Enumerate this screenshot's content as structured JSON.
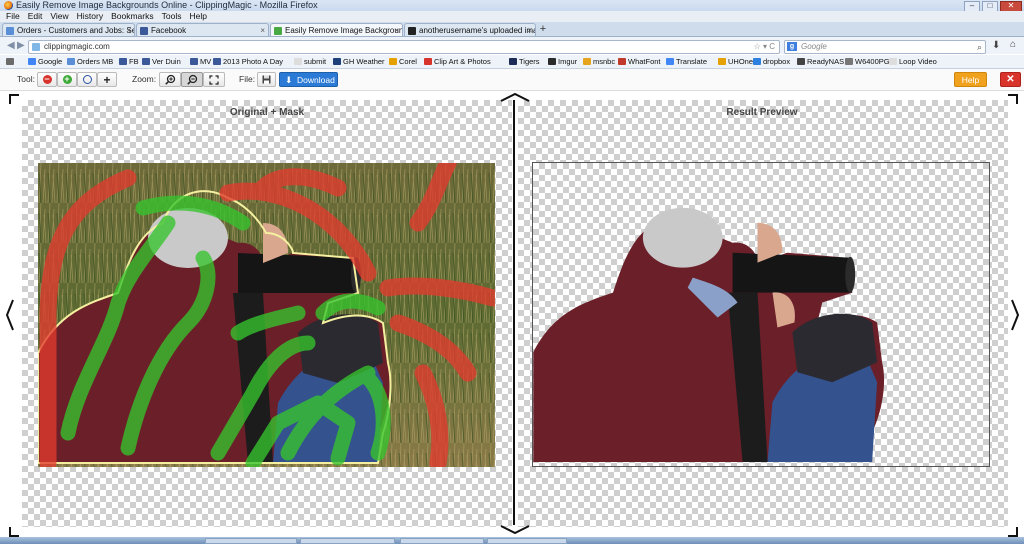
{
  "window": {
    "title": "Easily Remove Image Backgrounds Online - ClippingMagic - Mozilla Firefox",
    "controls": {
      "minimize": "–",
      "maximize": "□",
      "close": "✕"
    }
  },
  "menu": [
    "File",
    "Edit",
    "View",
    "History",
    "Bookmarks",
    "Tools",
    "Help"
  ],
  "tabs": [
    {
      "label": "Orders - Customers and Jobs: Select ...",
      "active": false,
      "icon_color": "#5a8fd8"
    },
    {
      "label": "Facebook",
      "active": false,
      "icon_color": "#3b5998"
    },
    {
      "label": "Easily Remove Image Backgrounds O...",
      "active": true,
      "icon_color": "#49a942"
    },
    {
      "label": "anotherusername's uploaded images ...",
      "active": false,
      "icon_color": "#222222"
    }
  ],
  "new_tab": "+",
  "nav": {
    "url": "clippingmagic.com",
    "url_icons": "☆ ▾ C",
    "search_engine": "g",
    "search_placeholder": "Google",
    "search_icon": "⌕"
  },
  "bookmarks": [
    {
      "label": "",
      "icon_color": "#6b6b6b"
    },
    {
      "label": "Google",
      "icon_color": "#4285f4"
    },
    {
      "label": "Orders MB",
      "icon_color": "#5a8fd8"
    },
    {
      "label": "FB",
      "icon_color": "#3b5998"
    },
    {
      "label": "Ver Duin",
      "icon_color": "#3b5998"
    },
    {
      "label": "MV",
      "icon_color": "#3b5998"
    },
    {
      "label": "2013 Photo A Day",
      "icon_color": "#3b5998"
    },
    {
      "label": "submit",
      "icon_color": "#dddddd"
    },
    {
      "label": "GH Weather",
      "icon_color": "#1d3f7a"
    },
    {
      "label": "Corel",
      "icon_color": "#e5a100"
    },
    {
      "label": "Clip Art & Photos",
      "icon_color": "#d8332a"
    },
    {
      "label": "Tigers",
      "icon_color": "#1d2b57"
    },
    {
      "label": "Imgur",
      "icon_color": "#2b2b2b"
    },
    {
      "label": "msnbc",
      "icon_color": "#e7a41f"
    },
    {
      "label": "WhatFont",
      "icon_color": "#c0392b"
    },
    {
      "label": "Translate",
      "icon_color": "#4285f4"
    },
    {
      "label": "UHOne",
      "icon_color": "#e5a100"
    },
    {
      "label": "dropbox",
      "icon_color": "#2d7fe0"
    },
    {
      "label": "ReadyNAS",
      "icon_color": "#444444"
    },
    {
      "label": "W6400PG",
      "icon_color": "#777777"
    },
    {
      "label": "Loop Video",
      "icon_color": "#dddddd"
    }
  ],
  "toolbar": {
    "tool_label": "Tool:",
    "zoom_label": "Zoom:",
    "file_label": "File:",
    "tool_buttons": [
      {
        "name": "remove-tool",
        "glyph": "−",
        "color": "#d9342b"
      },
      {
        "name": "keep-tool",
        "glyph": "+",
        "color": "#3aa936"
      },
      {
        "name": "ring-tool",
        "glyph": "",
        "color": "#2a4fa8"
      },
      {
        "name": "plus-tool",
        "glyph": "+",
        "color": "#222222"
      }
    ],
    "download_label": "Download",
    "help_label": "Help",
    "close_label": "✕"
  },
  "panes": {
    "left_title": "Original + Mask",
    "right_title": "Result Preview"
  },
  "colors": {
    "mask_red": "#e23b2e",
    "mask_green": "#36c42d",
    "download_blue": "#2a7ad6",
    "help_orange": "#f0a11e",
    "close_red": "#d9342b"
  }
}
